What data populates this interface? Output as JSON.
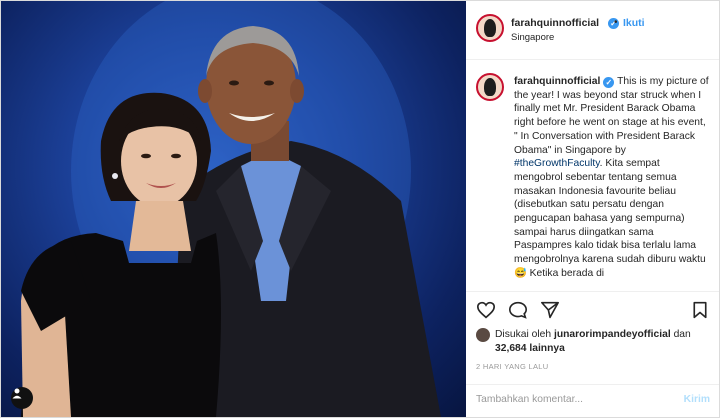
{
  "post": {
    "username": "farahquinnofficial",
    "follow_label": "Ikuti",
    "separator": "•",
    "location": "Singapore",
    "caption_text": "This is my picture of the year! I was beyond star struck when I finally met Mr. President Barack Obama right before he went on stage at his event, \" In Conversation with President Barack Obama\" in Singapore by",
    "caption_hashtag": "#theGrowthFaculty",
    "caption_tail": ". Kita sempat mengobrol sebentar tentang semua masakan Indonesia favourite beliau (disebutkan satu persatu dengan pengucapan bahasa yang sempurna) sampai harus diingatkan sama Paspampres kalo tidak bisa terlalu lama mengobrolnya karena sudah diburu waktu 😅 Ketika berada di",
    "likes_prefix": "Disukai oleh",
    "likes_user": "junarorimpandeyofficial",
    "likes_and": "dan",
    "likes_count": "32,684 lainnya",
    "time_ago": "2 HARI YANG LALU",
    "comment_placeholder": "Tambahkan komentar...",
    "send_label": "Kirim"
  },
  "icons": {
    "verified": "verified-badge-icon",
    "like": "heart-icon",
    "comment": "comment-bubble-icon",
    "share": "share-arrow-icon",
    "save": "bookmark-icon",
    "user_tag": "person-tag-icon"
  },
  "colors": {
    "link_blue": "#3897f0",
    "story_ring": "#c7102f",
    "photo_background": "#1b3f96",
    "hashtag": "#003569"
  }
}
